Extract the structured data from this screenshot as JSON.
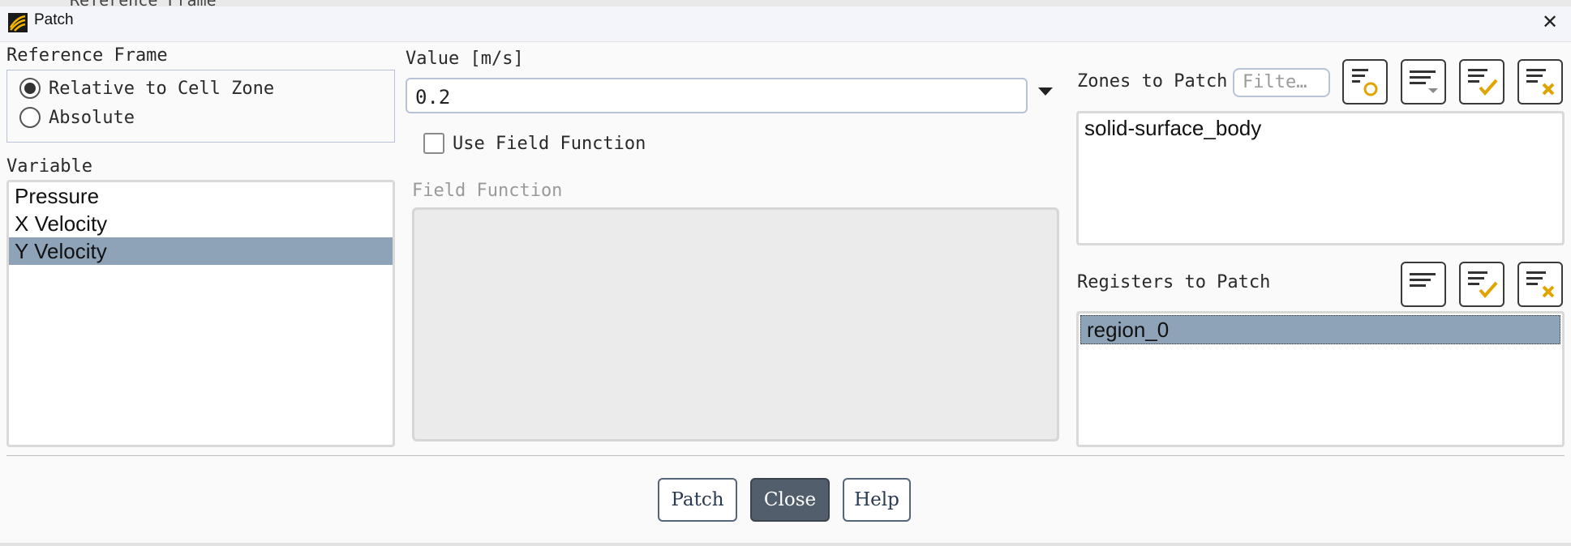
{
  "window": {
    "title": "Patch",
    "close_glyph": "✕",
    "behind_text": "Reference Frame"
  },
  "reference_frame": {
    "label": "Reference Frame",
    "options": [
      {
        "label": "Relative to Cell Zone",
        "selected": true
      },
      {
        "label": "Absolute",
        "selected": false
      }
    ]
  },
  "variable": {
    "label": "Variable",
    "items": [
      {
        "label": "Pressure",
        "selected": false
      },
      {
        "label": "X Velocity",
        "selected": false
      },
      {
        "label": "Y Velocity",
        "selected": true
      }
    ]
  },
  "value": {
    "label": "Value [m/s]",
    "value": "0.2"
  },
  "use_field_function": {
    "label": "Use Field Function",
    "checked": false
  },
  "field_function": {
    "label": "Field Function"
  },
  "zones_to_patch": {
    "label": "Zones to Patch",
    "filter_placeholder": "Filte…",
    "items": [
      {
        "label": "solid-surface_body",
        "selected": false
      }
    ],
    "toolbar_icons": [
      "filter-match-icon",
      "filter-dropdown-icon",
      "select-all-icon",
      "deselect-all-icon"
    ]
  },
  "registers_to_patch": {
    "label": "Registers to Patch",
    "items": [
      {
        "label": "region_0",
        "selected": true
      }
    ],
    "toolbar_icons": [
      "filter-dropdown-icon",
      "select-all-icon",
      "deselect-all-icon"
    ]
  },
  "buttons": {
    "patch": "Patch",
    "close": "Close",
    "help": "Help"
  },
  "colors": {
    "selection": "#8ea3b7",
    "primary_button": "#525e6c",
    "icon_accent": "#e0a400"
  }
}
